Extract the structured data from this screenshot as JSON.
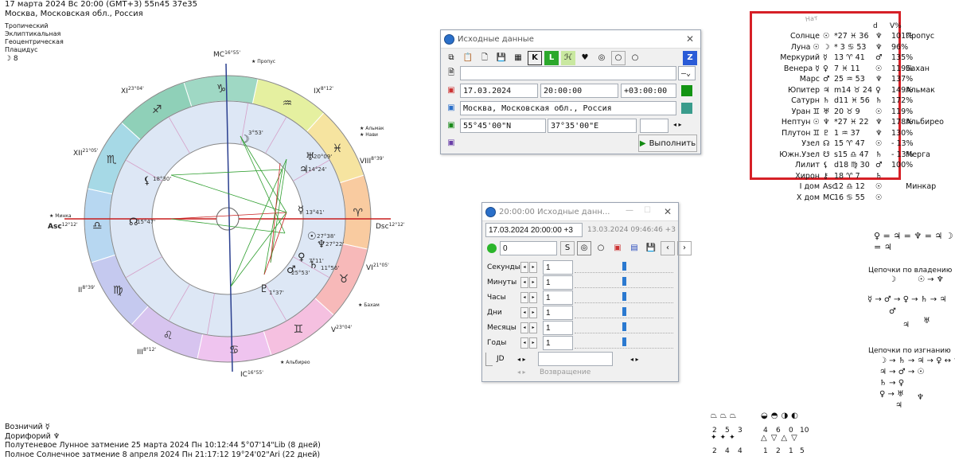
{
  "header": {
    "line1": "17 марта 2024  Вс  20:00 (GMT+3) 55n45  37e35",
    "line2": "Москва, Московская обл., Россия",
    "line3": "Тропический",
    "line4": "Эклиптикальная",
    "line5": "Геоцентрическая",
    "line6": "Плацидус",
    "line7": "☽  8"
  },
  "chart": {
    "mc": "MC",
    "mc_deg": "16°55'",
    "ic": "IC",
    "ic_deg": "16°55'",
    "asc": "Asc",
    "dsc": "Dsc",
    "dsc_deg": "12°12'",
    "asc_deg": "12°12'",
    "houses": [
      {
        "num": "XI",
        "deg": "23°04'"
      },
      {
        "num": "XII",
        "deg": "21°05'"
      },
      {
        "num": "II",
        "deg": "8°39'"
      },
      {
        "num": "III",
        "deg": "8°12'"
      },
      {
        "num": "IX",
        "deg": "8°12'"
      },
      {
        "num": "VIII",
        "deg": "8°39'"
      },
      {
        "num": "VI",
        "deg": "21°05'"
      },
      {
        "num": "V",
        "deg": "23°04'"
      }
    ],
    "stars": [
      "Пропус",
      "Альмак",
      "Нави",
      "Минка",
      "Бахам",
      "Альбирео"
    ],
    "planet_labels": [
      "3°53'",
      "20°09'",
      "14°24'",
      "18°30'",
      "13°41'",
      "15°47'",
      "27°38'",
      "27°22'",
      "7°11'",
      "11°56'",
      "25°53'",
      "1°37'"
    ]
  },
  "win1": {
    "title": "Исходные данные",
    "date": "17.03.2024",
    "time": "20:00:00",
    "tz": "+03:00:00",
    "place": "Москва, Московская обл., Россия",
    "lat": "55°45'00\"N",
    "lon": "37°35'00\"E",
    "run_label": "Выполнить"
  },
  "win2": {
    "title": "20:00:00 Исходные данн...",
    "datetime": "17.03.2024  20:00:00  +3",
    "datetime2": "13.03.2024   09:46:46  +3",
    "counter": "0",
    "rows": [
      {
        "label": "Секунды",
        "value": "1"
      },
      {
        "label": "Минуты",
        "value": "1"
      },
      {
        "label": "Часы",
        "value": "1"
      },
      {
        "label": "Дни",
        "value": "1"
      },
      {
        "label": "Месяцы",
        "value": "1"
      },
      {
        "label": "Годы",
        "value": "1"
      }
    ],
    "jd_label": "JD",
    "return_label": "Возвращение"
  },
  "table": {
    "header_nat": "Нат",
    "header_d": "d",
    "header_v": "V%",
    "rows": [
      {
        "name": "Солнце",
        "g": "☉",
        "pos": "*27 ♓ 36",
        "r": "♆",
        "v": "101%",
        "star": "Пропус"
      },
      {
        "name": "Луна ☉",
        "g": "☽",
        "pos": "* 3 ♋ 53",
        "r": "♆",
        "v": "96%",
        "star": ""
      },
      {
        "name": "Меркурий",
        "g": "☿",
        "pos": "13 ♈ 41",
        "r": "♂",
        "v": "135%",
        "star": ""
      },
      {
        "name": "Венера ☿",
        "g": "♀",
        "pos": "7 ♓ 11",
        "r": "☉",
        "v": "119%",
        "star": "Бахан"
      },
      {
        "name": "Марс",
        "g": "♂",
        "pos": "25 ♒ 53",
        "r": "♆",
        "v": "137%",
        "star": ""
      },
      {
        "name": "Юпитер",
        "g": "♃",
        "pos": "m14 ♉ 24",
        "r": "♀",
        "v": "149%",
        "star": "Альмак"
      },
      {
        "name": "Сатурн",
        "g": "♄",
        "pos": "d11 ♓ 56",
        "r": "♄",
        "v": "172%",
        "star": ""
      },
      {
        "name": "Уран ♊",
        "g": "♅",
        "pos": "20 ♉ 9",
        "r": "☉",
        "v": "119%",
        "star": ""
      },
      {
        "name": "Нептун ☉",
        "g": "♆",
        "pos": "*27 ♓ 22",
        "r": "♆",
        "v": "178%",
        "star": "Альбирео"
      },
      {
        "name": "Плутон ♊",
        "g": "♇",
        "pos": "1 ♒ 37",
        "r": "♆",
        "v": "130%",
        "star": ""
      },
      {
        "name": "Узел",
        "g": "☊",
        "pos": "15 ♈ 47",
        "r": "☉",
        "v": "- 13%",
        "star": ""
      },
      {
        "name": "Южн.Узел",
        "g": "☋",
        "pos": "s15 ♎ 47",
        "r": "♄",
        "v": "- 13%",
        "star": "Мерга"
      },
      {
        "name": "Лилит",
        "g": "⚸",
        "pos": "d18 ♍ 30",
        "r": "♂",
        "v": "100%",
        "star": ""
      },
      {
        "name": "Хирон",
        "g": "⚷",
        "pos": "18 ♈ 7",
        "r": "♄",
        "v": "",
        "star": ""
      },
      {
        "name": "I дом",
        "g": "Asc",
        "pos": "12 ♎ 12",
        "r": "☉",
        "v": "",
        "star": "Минкар"
      },
      {
        "name": "X дом",
        "g": "MC",
        "pos": "16 ♋ 55",
        "r": "☉",
        "v": "",
        "star": ""
      }
    ]
  },
  "aspects_line": "♀ = ♃ = ♆ = ♃ ☽ = ♃",
  "chains_owner_title": "Цепочки по владению",
  "chains_owner": [
    "☽",
    "☉ → ♆",
    "☿ → ♂ → ♀ → ♄ → ♃",
    "♂",
    "♃",
    "♅"
  ],
  "chains_exile_title": "Цепочки по изгнанию",
  "chains_exile": [
    "☽ → ♄ → ♃ → ♀ ↔ ♆",
    "♃ → ♂ → ☉",
    "♄ → ♀",
    "♀ → ♅",
    "♃",
    "♆"
  ],
  "footer": {
    "line1": "Возничий  ☿",
    "line2": "Дорифорий  ♆",
    "line3": "Полутеневое Лунное затмение 25 марта 2024 Пн 10:12:44  5°07'14\"Lib (8 дней)",
    "line4": "Полное Солнечное затмение 8 апреля 2024 Пн 21:17:12 19°24'02\"Ari (22 дней)"
  },
  "stats": {
    "row1": [
      "2",
      "5",
      "3",
      "4",
      "6",
      "0",
      "10"
    ],
    "row2": [
      "2",
      "4",
      "4",
      "1",
      "2",
      "1",
      "5"
    ]
  }
}
